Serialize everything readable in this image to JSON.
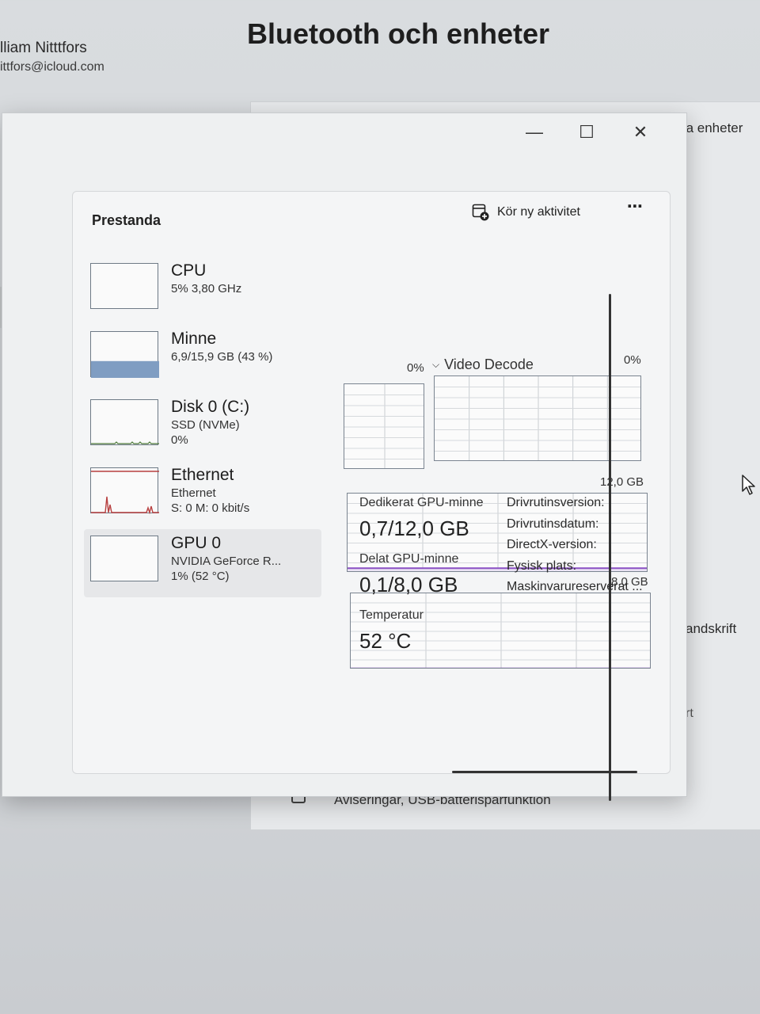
{
  "background": {
    "user_name": "lliam Nitttfors",
    "user_email": "ittfors@icloud.com",
    "page_title": "Bluetooth och enheter",
    "right_link": "ndra enheter",
    "right_handwriting": "andskrift",
    "right_rt": "rt",
    "notifications": "Aviseringar, USB-batterisparfunktion"
  },
  "task_manager": {
    "window_buttons": {
      "minimize": "—",
      "maximize": "☐",
      "close": "✕"
    },
    "section_title": "Prestanda",
    "run_new_task": "Kör ny aktivitet",
    "more": "⋯",
    "perf_items": [
      {
        "name": "CPU",
        "sub1": "5% 3,80 GHz",
        "sub2": ""
      },
      {
        "name": "Minne",
        "sub1": "6,9/15,9 GB (43 %)",
        "sub2": ""
      },
      {
        "name": "Disk 0 (C:)",
        "sub1": "SSD (NVMe)",
        "sub2": "0%"
      },
      {
        "name": "Ethernet",
        "sub1": "Ethernet",
        "sub2": "S: 0 M: 0 kbit/s"
      },
      {
        "name": "GPU 0",
        "sub1": "NVIDIA GeForce R...",
        "sub2": "1% (52 °C)"
      }
    ],
    "graphs": {
      "left_pct": "0%",
      "engine_label": "Video Decode",
      "right_pct": "0%",
      "dedicated_max": "12,0 GB",
      "shared_max": "8,0 GB"
    },
    "stats": {
      "dedicated_label": "Dedikerat GPU-minne",
      "dedicated_value": "0,7/12,0 GB",
      "shared_label": "Delat GPU-minne",
      "shared_value": "0,1/8,0 GB",
      "temp_label": "Temperatur",
      "temp_value": "52 °C"
    },
    "props": [
      "Drivrutinsversion:",
      "Drivrutinsdatum:",
      "DirectX-version:",
      "Fysisk plats:",
      "Maskinvarureserverat ..."
    ],
    "memory_fill": 0.43,
    "dedicated_fill": 0.058,
    "shared_fill": 0.0125
  }
}
